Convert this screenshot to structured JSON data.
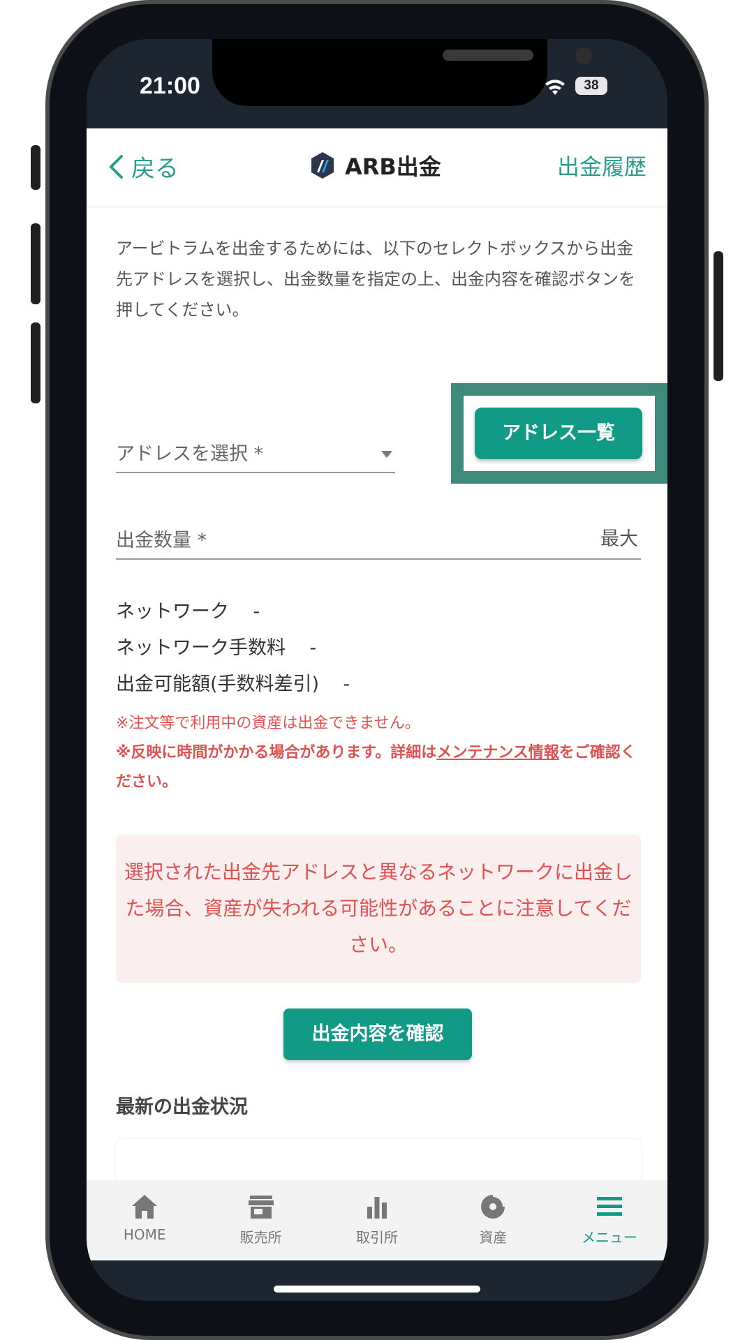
{
  "status_bar": {
    "time": "21:00",
    "battery": "38"
  },
  "nav": {
    "back_label": "戻る",
    "title": "ARB出金",
    "history_label": "出金履歴"
  },
  "description": "アービトラムを出金するためには、以下のセレクトボックスから出金先アドレスを選択し、出金数量を指定の上、出金内容を確認ボタンを押してください。",
  "form": {
    "address_label": "アドレスを選択 *",
    "address_list_button": "アドレス一覧",
    "amount_label": "出金数量 *",
    "max_label": "最大"
  },
  "info": [
    {
      "label": "ネットワーク",
      "value": "-"
    },
    {
      "label": "ネットワーク手数料",
      "value": "-"
    },
    {
      "label": "出金可能額(手数料差引)",
      "value": "-"
    }
  ],
  "notes": {
    "note1": "※注文等で利用中の資産は出金できません。",
    "note2_prefix": "※反映に時間がかかる場合があります。詳細は",
    "note2_link": "メンテナンス情報",
    "note2_suffix": "をご確認ください。"
  },
  "warning": "選択された出金先アドレスと異なるネットワークに出金した場合、資産が失われる可能性があることに注意してください。",
  "confirm_button": "出金内容を確認",
  "latest_section": "最新の出金状況",
  "tabs": [
    {
      "label": "HOME",
      "icon": "home-icon"
    },
    {
      "label": "販売所",
      "icon": "store-icon"
    },
    {
      "label": "取引所",
      "icon": "bar-chart-icon"
    },
    {
      "label": "資産",
      "icon": "pie-chart-icon"
    },
    {
      "label": "メニュー",
      "icon": "menu-icon"
    }
  ],
  "colors": {
    "accent": "#119a86",
    "warning_text": "#e05252",
    "highlight_frame": "#3f8a7a"
  }
}
